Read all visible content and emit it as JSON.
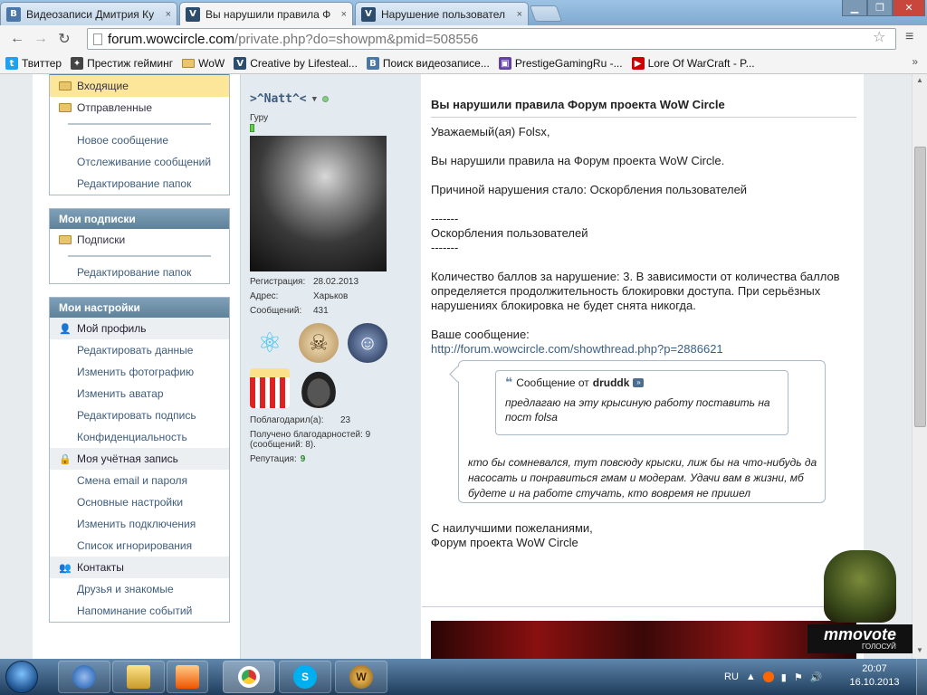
{
  "browser": {
    "tabs": [
      {
        "icon": "vk-icon",
        "title": "Видеозаписи Дмитрия Ку",
        "close": "×"
      },
      {
        "icon": "wowcircle-icon",
        "title": "Вы нарушили правила Ф",
        "close": "×"
      },
      {
        "icon": "wowcircle-icon",
        "title": "Нарушение пользовател",
        "close": "×"
      }
    ],
    "url": {
      "domain": "forum.wowcircle.com",
      "path": "/private.php?do=showpm&pmid=508556"
    },
    "bookmarks": [
      {
        "icon": "twitter-icon",
        "label": "Твиттер",
        "color": "#1da1f2"
      },
      {
        "icon": "gamepad-icon",
        "label": "Престиж гейминг",
        "color": "#333333"
      },
      {
        "icon": "folder-icon",
        "label": "WoW",
        "color": "#e8c46a"
      },
      {
        "icon": "wowcircle-icon",
        "label": "Creative by Lifesteal...",
        "color": "#2b4c6c"
      },
      {
        "icon": "vk-icon",
        "label": "Поиск видеозаписе...",
        "color": "#4a76a8"
      },
      {
        "icon": "twitch-icon",
        "label": "PrestigeGamingRu -...",
        "color": "#6441a5"
      },
      {
        "icon": "youtube-icon",
        "label": "Lore Of WarCraft - P...",
        "color": "#cc0000"
      }
    ],
    "bookmarks_more": "»"
  },
  "sidebar": {
    "messages": {
      "items": [
        {
          "label": "Входящие",
          "type": "folder",
          "selected": true
        },
        {
          "label": "Отправленные",
          "type": "folder"
        },
        {
          "label": "",
          "type": "sep"
        },
        {
          "label": "Новое сообщение",
          "type": "link"
        },
        {
          "label": "Отслеживание сообщений",
          "type": "link"
        },
        {
          "label": "Редактирование папок",
          "type": "link"
        }
      ]
    },
    "subscriptions": {
      "title": "Мои подписки",
      "items": [
        {
          "label": "Подписки",
          "type": "folder"
        },
        {
          "label": "",
          "type": "sep"
        },
        {
          "label": "Редактирование папок",
          "type": "link"
        }
      ]
    },
    "settings": {
      "title": "Мои настройки",
      "items": [
        {
          "label": "Мой профиль",
          "type": "cat",
          "icon": "user-icon"
        },
        {
          "label": "Редактировать данные",
          "type": "link"
        },
        {
          "label": "Изменить фотографию",
          "type": "link"
        },
        {
          "label": "Изменить аватар",
          "type": "link"
        },
        {
          "label": "Редактировать подпись",
          "type": "link"
        },
        {
          "label": "Конфиденциальность",
          "type": "link"
        },
        {
          "label": "Моя учётная запись",
          "type": "cat",
          "icon": "lock-icon"
        },
        {
          "label": "Смена email и пароля",
          "type": "link"
        },
        {
          "label": "Основные настройки",
          "type": "link"
        },
        {
          "label": "Изменить подключения",
          "type": "link"
        },
        {
          "label": "Список игнорирования",
          "type": "link"
        },
        {
          "label": "Контакты",
          "type": "cat",
          "icon": "contacts-icon"
        },
        {
          "label": "Друзья и знакомые",
          "type": "link"
        },
        {
          "label": "Напоминание событий",
          "type": "link"
        }
      ]
    }
  },
  "user": {
    "name": ">^Natt^<",
    "rank": "Гуру",
    "details": [
      {
        "k": "Регистрация:",
        "v": "28.02.2013"
      },
      {
        "k": "Адрес:",
        "v": "Харьков"
      },
      {
        "k": "Сообщений:",
        "v": "431"
      }
    ],
    "awards": [
      "atom-award-icon",
      "skull-award-icon",
      "police-award-icon",
      "popcorn-award-icon",
      "cowboy-hat-award-icon"
    ],
    "thanks_given_label": "Поблагодарил(а):",
    "thanks_given": "23",
    "thanks_received": "Получено благодарностей: 9 (сообщений: 8).",
    "reputation_label": "Репутация:",
    "reputation": "9"
  },
  "message": {
    "title": "Вы нарушили правила Форум проекта WoW Circle",
    "greeting": "Уважаемый(ая) Folsx,",
    "line1": "Вы нарушили правила на Форум проекта WoW Circle.",
    "reason": "Причиной нарушения стало: Оскорбления пользователей",
    "dash1": "-------",
    "reason_name": "Оскорбления пользователей",
    "dash2": "-------",
    "points": "Количество баллов за нарушение: 3. В зависимости от количества баллов определяется продолжительность блокировки доступа. При серьёзных нарушениях блокировка не будет снята никогда.",
    "your_post": "Ваше сообщение:",
    "post_url": "http://forum.wowcircle.com/showthread.php?p=2886621",
    "quote": {
      "label": "Сообщение от",
      "author": "druddk",
      "text": "предлагаю на эту крысиную работу поставить на пост folsa"
    },
    "outer_text": "кто бы сомневался, тут повсюду крыски, лиж бы на что-нибудь да насосать и понравиться гмам и модерам. Удачи вам в жизни, мб будете и на работе стучать, кто вовремя не пришел",
    "closing1": "С наилучшими пожеланиями,",
    "closing2": "Форум проекта WoW Circle"
  },
  "widget": {
    "name": "mmovote",
    "sub": "ГОЛОСУЙ"
  },
  "taskbar": {
    "apps": [
      "ie-icon",
      "explorer-icon",
      "media-player-icon",
      "chrome-icon",
      "skype-icon",
      "wow-icon"
    ],
    "lang": "RU",
    "time": "20:07",
    "date": "16.10.2013"
  }
}
